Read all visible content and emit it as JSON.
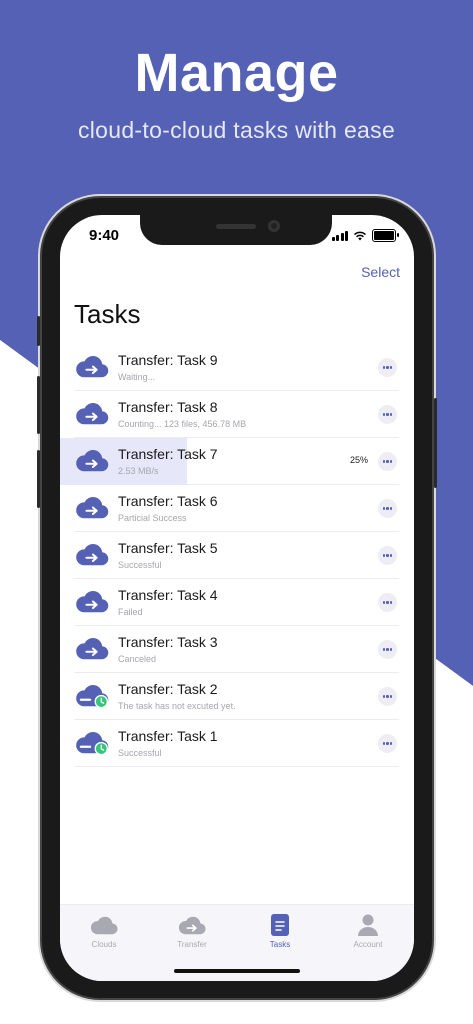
{
  "promo": {
    "headline": "Manage",
    "subline": "cloud-to-cloud tasks with ease"
  },
  "status_bar": {
    "time": "9:40"
  },
  "header": {
    "select_label": "Select",
    "title": "Tasks"
  },
  "tasks": [
    {
      "name": "Transfer: Task 9",
      "status": "Waiting...",
      "icon": "cloud-transfer-icon",
      "percent": ""
    },
    {
      "name": "Transfer: Task 8",
      "status": "Counting... 123 files, 456.78 MB",
      "icon": "cloud-transfer-icon",
      "percent": ""
    },
    {
      "name": "Transfer: Task 7",
      "status": "2.53 MB/s",
      "icon": "cloud-transfer-icon",
      "percent": "25%",
      "progress": 0.36
    },
    {
      "name": "Transfer: Task 6",
      "status": "Particial Success",
      "icon": "cloud-transfer-icon",
      "percent": ""
    },
    {
      "name": "Transfer: Task 5",
      "status": "Successful",
      "icon": "cloud-transfer-icon",
      "percent": ""
    },
    {
      "name": "Transfer: Task 4",
      "status": "Failed",
      "icon": "cloud-transfer-icon",
      "percent": ""
    },
    {
      "name": "Transfer: Task 3",
      "status": "Canceled",
      "icon": "cloud-transfer-icon",
      "percent": ""
    },
    {
      "name": "Transfer: Task 2",
      "status": "The task has not excuted yet.",
      "icon": "cloud-scheduled-icon",
      "percent": ""
    },
    {
      "name": "Transfer: Task 1",
      "status": "Successful",
      "icon": "cloud-scheduled-icon",
      "percent": ""
    }
  ],
  "tabbar": {
    "tabs": [
      {
        "label": "Clouds",
        "icon": "cloud-icon"
      },
      {
        "label": "Transfer",
        "icon": "cloud-transfer-icon"
      },
      {
        "label": "Tasks",
        "icon": "document-icon"
      },
      {
        "label": "Account",
        "icon": "person-icon"
      }
    ],
    "active_index": 2
  },
  "colors": {
    "brand": "#5461b4",
    "scheduled_badge": "#34c77b",
    "progress_bg": "#e6e8fa"
  }
}
